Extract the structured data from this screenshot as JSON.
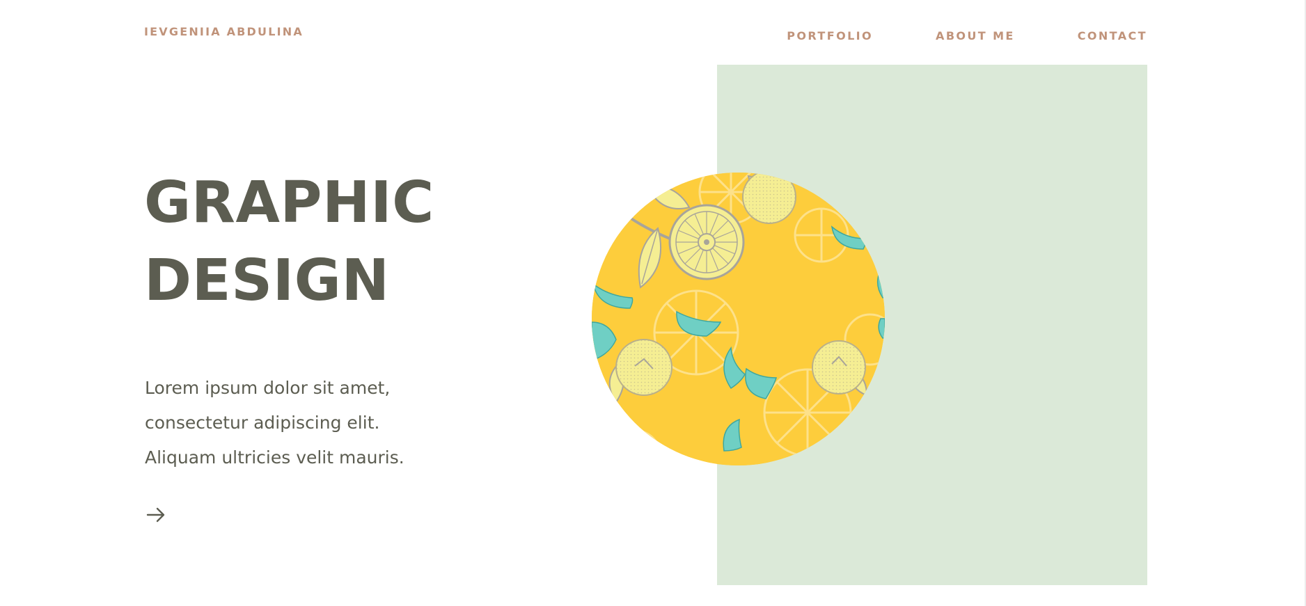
{
  "header": {
    "brand": "IEVGENIIA ABDULINA",
    "nav": [
      {
        "label": "PORTFOLIO"
      },
      {
        "label": "ABOUT ME"
      },
      {
        "label": "CONTACT"
      }
    ]
  },
  "hero": {
    "title_lines": [
      "GRAPHIC",
      "DESIGN"
    ],
    "text_lines": [
      "Lorem ipsum dolor sit amet,",
      "consectetur adipiscing elit.",
      "Aliquam ultricies velit mauris."
    ],
    "arrow_icon": "arrow-right-icon",
    "image_icon": "citrus-pattern-illustration"
  },
  "colors": {
    "accent": "#c0937a",
    "text": "#5c5d51",
    "panel": "#dbe9d8",
    "circle": "#fdcd3c",
    "teal": "#6fcfc4",
    "pale_yellow": "#f5ee93"
  }
}
